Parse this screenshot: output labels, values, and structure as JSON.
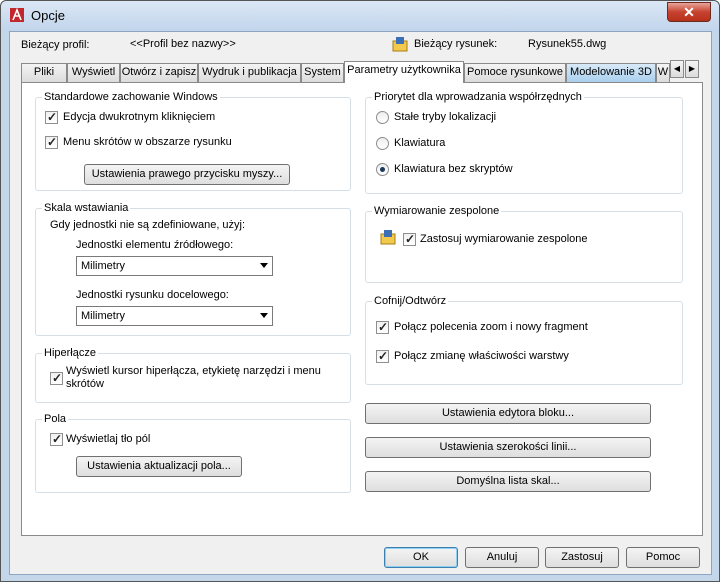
{
  "window": {
    "title": "Opcje"
  },
  "profile": {
    "label": "Bieżący profil:",
    "value": "<<Profil bez nazwy>>",
    "drawing_label": "Bieżący rysunek:",
    "drawing_value": "Rysunek55.dwg"
  },
  "tabs": [
    "Pliki",
    "Wyświetl",
    "Otwórz i zapisz",
    "Wydruk i publikacja",
    "System",
    "Parametry użytkownika",
    "Pomoce rysunkowe",
    "Modelowanie 3D",
    "W"
  ],
  "active_tab": "Parametry użytkownika",
  "windows_behavior": {
    "legend": "Standardowe zachowanie Windows",
    "dblclick": "Edycja dwukrotnym kliknięciem",
    "shortcut_menu": "Menu skrótów w obszarze rysunku",
    "right_click_button": "Ustawienia prawego przycisku myszy..."
  },
  "insert_scale": {
    "legend": "Skala wstawiania",
    "hint": "Gdy jednostki nie są zdefiniowane, użyj:",
    "source_label": "Jednostki elementu źródłowego:",
    "source_value": "Milimetry",
    "target_label": "Jednostki rysunku docelowego:",
    "target_value": "Milimetry"
  },
  "hyperlink": {
    "legend": "Hiperłącze",
    "text_line1": "Wyświetl kursor hiperłącza, etykietę narzędzi i menu",
    "text_line2": "skrótów"
  },
  "fields": {
    "legend": "Pola",
    "show_bg": "Wyświetlaj tło pól",
    "update_button": "Ustawienia aktualizacji pola..."
  },
  "coord_priority": {
    "legend": "Priorytet dla wprowadzania współrzędnych",
    "options": [
      "Stałe tryby lokalizacji",
      "Klawiatura",
      "Klawiatura bez skryptów"
    ],
    "selected": "Klawiatura bez skryptów"
  },
  "assoc_dim": {
    "legend": "Wymiarowanie zespolone",
    "apply": "Zastosuj wymiarowanie zespolone"
  },
  "undo_redo": {
    "legend": "Cofnij/Odtwórz",
    "combine_zoom": "Połącz polecenia zoom i nowy fragment",
    "combine_layer": "Połącz zmianę właściwości warstwy"
  },
  "right_buttons": {
    "block_editor": "Ustawienia edytora bloku...",
    "lineweight": "Ustawienia szerokości linii...",
    "scale_list": "Domyślna lista skal..."
  },
  "footer": {
    "ok": "OK",
    "cancel": "Anuluj",
    "apply": "Zastosuj",
    "help": "Pomoc"
  },
  "colors": {
    "title_bg": "#c1d5ec",
    "close": "#c7432f",
    "accent": "#3c7fb1"
  }
}
